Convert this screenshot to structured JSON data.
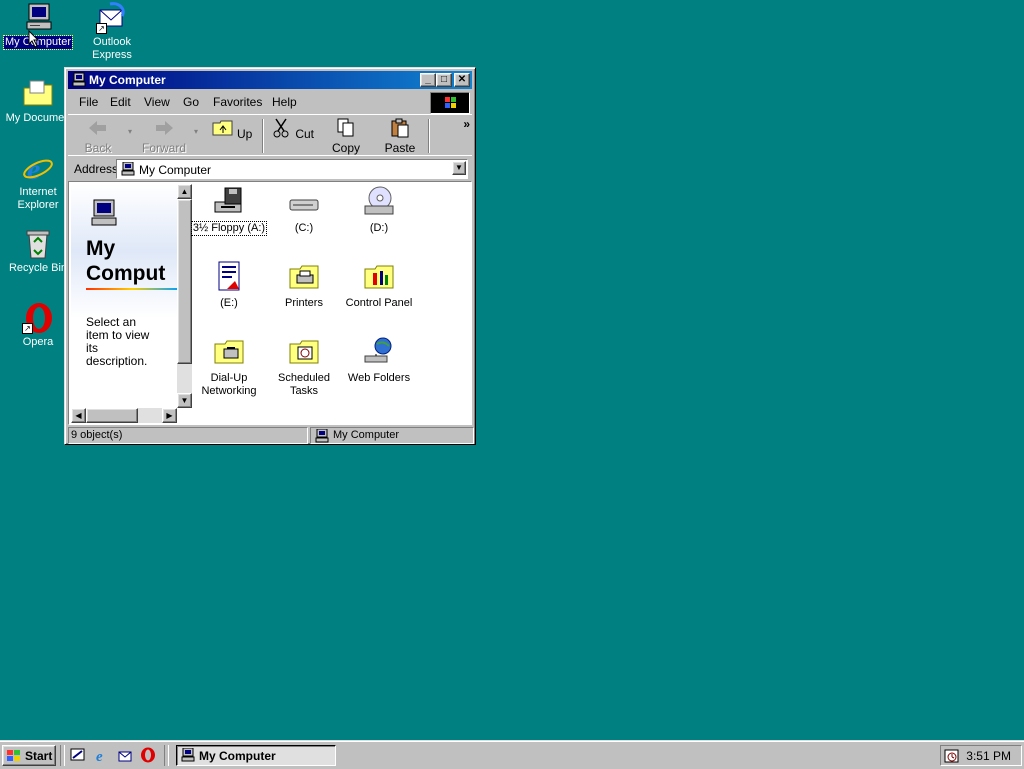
{
  "desktop": {
    "icons": [
      {
        "label": "My Computer",
        "icon": "my-computer-icon"
      },
      {
        "label": "Outlook\nExpress",
        "icon": "outlook-express-icon"
      },
      {
        "label": "My Documen",
        "icon": "my-documents-icon"
      },
      {
        "label": "Internet\nExplorer",
        "icon": "internet-explorer-icon"
      },
      {
        "label": "Recycle Bin",
        "icon": "recycle-bin-icon"
      },
      {
        "label": "Opera",
        "icon": "opera-icon"
      }
    ]
  },
  "window": {
    "title": "My Computer",
    "menu": [
      "File",
      "Edit",
      "View",
      "Go",
      "Favorites",
      "Help"
    ],
    "toolbar": {
      "back": "Back",
      "forward": "Forward",
      "up": "Up",
      "cut": "Cut",
      "copy": "Copy",
      "paste": "Paste",
      "more": "»"
    },
    "address": {
      "label": "Address",
      "value": "My Computer"
    },
    "left_pane": {
      "title": "My\nComput",
      "description": "Select an\nitem to view\nits\ndescription."
    },
    "items": [
      {
        "label": "3½ Floppy (A:)",
        "icon": "floppy-drive-icon"
      },
      {
        "label": "(C:)",
        "icon": "hard-drive-icon"
      },
      {
        "label": "(D:)",
        "icon": "cd-drive-icon"
      },
      {
        "label": "(E:)",
        "icon": "removable-drive-icon"
      },
      {
        "label": "Printers",
        "icon": "printers-folder-icon"
      },
      {
        "label": "Control Panel",
        "icon": "control-panel-icon"
      },
      {
        "label": "Dial-Up\nNetworking",
        "icon": "dialup-networking-icon"
      },
      {
        "label": "Scheduled\nTasks",
        "icon": "scheduled-tasks-icon"
      },
      {
        "label": "Web Folders",
        "icon": "web-folders-icon"
      }
    ],
    "status": {
      "count": "9 object(s)",
      "location": "My Computer"
    }
  },
  "taskbar": {
    "start_label": "Start",
    "task_label": "My Computer",
    "clock": "3:51 PM"
  },
  "colors": {
    "desktop": "#008080",
    "title_active": "#000080",
    "title_gradient_end": "#1084d0",
    "face": "#c0c0c0"
  }
}
